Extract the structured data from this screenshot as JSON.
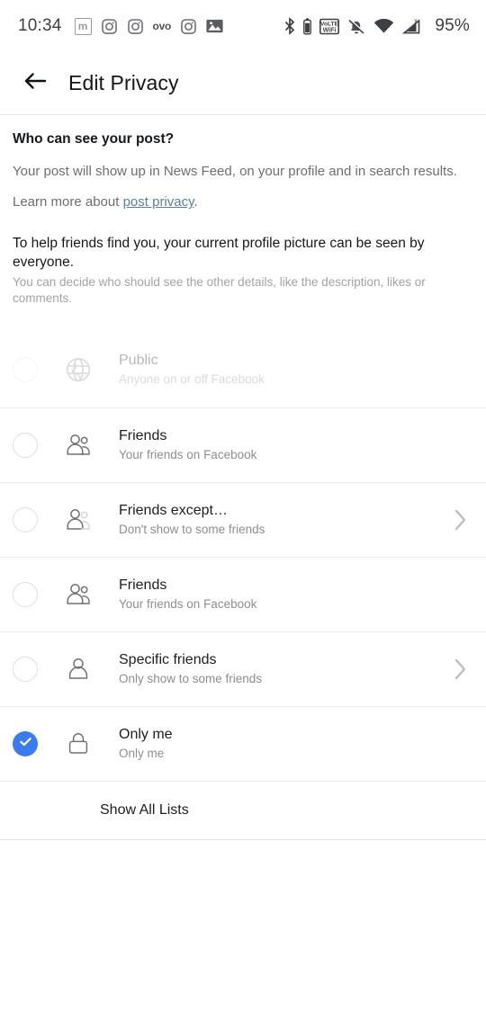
{
  "status_bar": {
    "clock": "10:34",
    "left_icons": [
      {
        "name": "messenger-lite-icon",
        "glyph": "m"
      },
      {
        "name": "instagram-icon"
      },
      {
        "name": "instagram-icon"
      },
      {
        "name": "ovo-icon",
        "glyph": "ovo"
      },
      {
        "name": "instagram-icon"
      },
      {
        "name": "gallery-icon"
      }
    ],
    "right_icons": [
      {
        "name": "bluetooth-icon"
      },
      {
        "name": "bluetooth-battery-icon"
      },
      {
        "name": "vowifi-icon",
        "label": "VoWiFi"
      },
      {
        "name": "notifications-muted-icon"
      },
      {
        "name": "wifi-icon"
      },
      {
        "name": "cellular-signal-off-icon"
      }
    ],
    "battery_percent": "95%"
  },
  "app_bar": {
    "back_label": "Back",
    "title": "Edit Privacy"
  },
  "intro": {
    "heading": "Who can see your post?",
    "body": "Your post will show up in News Feed, on your profile and in search results.",
    "learn_prefix": "Learn more about ",
    "learn_link": "post privacy",
    "learn_suffix": "."
  },
  "notice": {
    "title": "To help friends find you, your current profile picture can be seen by everyone.",
    "subtitle": "You can decide who should see the other details, like the description, likes or comments."
  },
  "options": [
    {
      "id": "public",
      "icon": "globe-icon",
      "title": "Public",
      "subtitle": "Anyone on or off Facebook",
      "selected": false,
      "disabled": true,
      "chevron": false
    },
    {
      "id": "friends",
      "icon": "friends-icon",
      "title": "Friends",
      "subtitle": "Your friends on Facebook",
      "selected": false,
      "disabled": false,
      "chevron": false
    },
    {
      "id": "friends-except",
      "icon": "friends-except-icon",
      "title": "Friends except…",
      "subtitle": "Don't show to some friends",
      "selected": false,
      "disabled": false,
      "chevron": true
    },
    {
      "id": "friends-2",
      "icon": "friends-icon",
      "title": "Friends",
      "subtitle": "Your friends on Facebook",
      "selected": false,
      "disabled": false,
      "chevron": false
    },
    {
      "id": "specific-friends",
      "icon": "person-icon",
      "title": "Specific friends",
      "subtitle": "Only show to some friends",
      "selected": false,
      "disabled": false,
      "chevron": true
    },
    {
      "id": "only-me",
      "icon": "lock-icon",
      "title": "Only me",
      "subtitle": "Only me",
      "selected": true,
      "disabled": false,
      "chevron": false
    }
  ],
  "show_all_lists": {
    "label": "Show All Lists"
  },
  "colors": {
    "accent_blue": "#3a7ced",
    "link_blue": "#5d7f9c",
    "primary_text": "#1b1e22",
    "secondary_text": "#8b8e92",
    "divider": "#e9eaec",
    "background": "#ffffff"
  }
}
